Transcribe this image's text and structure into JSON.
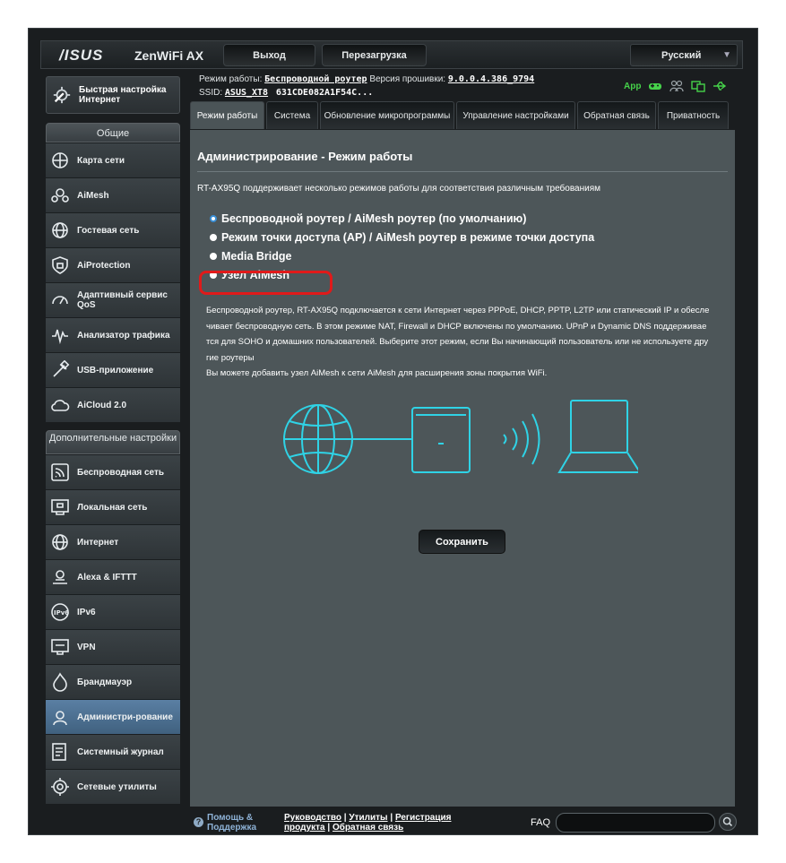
{
  "header": {
    "brand": "/ISUS",
    "model": "ZenWiFi AX",
    "logout_label": "Выход",
    "reboot_label": "Перезагрузка",
    "language": "Русский"
  },
  "info": {
    "mode_label": "Режим работы:",
    "mode_value": "Беспроводной роутер",
    "firmware_label": "Версия прошивки:",
    "firmware_value": "9.0.0.4.386_9794",
    "ssid_label": "SSID:",
    "ssid_value": "ASUS_XT8",
    "ssid_extra": "631CDE082A1F54C...",
    "app_label": "App"
  },
  "sidebar": {
    "quick_setup": "Быстрая настройка Интернет",
    "general_header": "Общие",
    "general_items": [
      {
        "label": "Карта сети",
        "icon": "network-map-icon"
      },
      {
        "label": "AiMesh",
        "icon": "aimesh-icon"
      },
      {
        "label": "Гостевая сеть",
        "icon": "guest-network-icon"
      },
      {
        "label": "AiProtection",
        "icon": "aiprotection-icon"
      },
      {
        "label": "Адаптивный сервис QoS",
        "icon": "qos-icon"
      },
      {
        "label": "Анализатор трафика",
        "icon": "traffic-analyzer-icon"
      },
      {
        "label": "USB-приложение",
        "icon": "usb-icon"
      },
      {
        "label": "AiCloud 2.0",
        "icon": "aicloud-icon"
      }
    ],
    "advanced_header": "Дополнительные настройки",
    "advanced_items": [
      {
        "label": "Беспроводная сеть",
        "icon": "wireless-icon"
      },
      {
        "label": "Локальная сеть",
        "icon": "lan-icon"
      },
      {
        "label": "Интернет",
        "icon": "wan-globe-icon"
      },
      {
        "label": "Alexa & IFTTT",
        "icon": "alexa-icon"
      },
      {
        "label": "IPv6",
        "icon": "ipv6-icon"
      },
      {
        "label": "VPN",
        "icon": "vpn-icon"
      },
      {
        "label": "Брандмауэр",
        "icon": "firewall-icon"
      },
      {
        "label": "Администри-рование",
        "icon": "administration-icon",
        "active": true
      },
      {
        "label": "Системный журнал",
        "icon": "system-log-icon"
      },
      {
        "label": "Сетевые утилиты",
        "icon": "network-tools-icon"
      }
    ]
  },
  "tabs": [
    {
      "label": "Режим работы",
      "active": true
    },
    {
      "label": "Система"
    },
    {
      "label": "Обновление микропрограммы"
    },
    {
      "label": "Управление настройками"
    },
    {
      "label": "Обратная связь"
    },
    {
      "label": "Приватность"
    }
  ],
  "content": {
    "title": "Администрирование - Режим работы",
    "description": "RT-AX95Q поддерживает несколько режимов работы для соответствия различным требованиям",
    "modes": [
      {
        "label": "Беспроводной роутер / AiMesh роутер (по умолчанию)",
        "selected": true
      },
      {
        "label": "Режим точки доступа (AP) / AiMesh роутер в режиме точки доступа",
        "selected": false
      },
      {
        "label": "Media Bridge",
        "selected": false
      },
      {
        "label": "Узел AiMesh",
        "selected": false
      }
    ],
    "mode_description_lines": [
      "Беспроводной роутер, RT-AX95Q подключается к сети Интернет через PPPoE, DHCP, PPTP, L2TP или статический IP и обесле",
      "чивает беспроводную сеть. В этом режиме NAT, Firewall и DHCP включены по умолчанию. UPnP и Dynamic DNS поддерживае",
      "тся для SOHO и домашних пользователей. Выберите этот режим, если Вы начинающий пользователь или не используете дру",
      "гие роутеры",
      "Вы можете добавить узел AiMesh к сети AiMesh для расширения зоны покрытия WiFi."
    ],
    "save_label": "Сохранить",
    "accent_color": "#2fd3e6"
  },
  "footer": {
    "help_line1": "Помощь &",
    "help_line2": "Поддержка",
    "link_manual": "Руководство",
    "link_utilities": "Утилиты",
    "link_registration": "Регистрация",
    "link_product": "продукта",
    "link_feedback": "Обратная связь",
    "faq_label": "FAQ",
    "search_value": ""
  }
}
